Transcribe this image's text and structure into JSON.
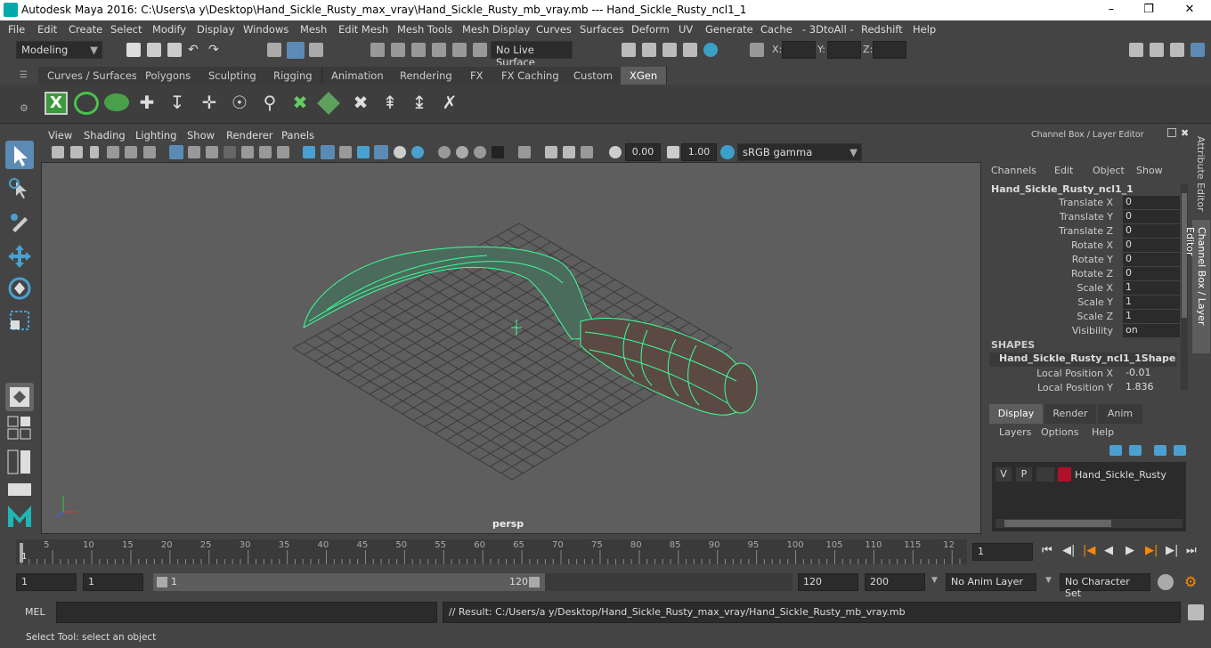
{
  "title": {
    "text": "Autodesk Maya 2016: C:\\Users\\a y\\Desktop\\Hand_Sickle_Rusty_max_vray\\Hand_Sickle_Rusty_mb_vray.mb   ---   Hand_Sickle_Rusty_ncl1_1"
  },
  "menu": [
    "File",
    "Edit",
    "Create",
    "Select",
    "Modify",
    "Display",
    "Windows",
    "Mesh",
    "Edit Mesh",
    "Mesh Tools",
    "Mesh Display",
    "Curves",
    "Surfaces",
    "Deform",
    "UV",
    "Generate",
    "Cache",
    "- 3DtoAll -",
    "Redshift",
    "Help"
  ],
  "status": {
    "mode": "Modeling",
    "live_surface": "No Live Surface",
    "x_label": "X:",
    "y_label": "Y:",
    "z_label": "Z:"
  },
  "shelf_tabs": [
    "Curves / Surfaces",
    "Polygons",
    "Sculpting",
    "Rigging",
    "Animation",
    "Rendering",
    "FX",
    "FX Caching",
    "Custom",
    "XGen"
  ],
  "viewport": {
    "menu": [
      "View",
      "Shading",
      "Lighting",
      "Show",
      "Renderer",
      "Panels"
    ],
    "exposure": "0.00",
    "gamma": "1.00",
    "color_space": "sRGB gamma",
    "camera": "persp"
  },
  "channel_box": {
    "header": "Channel Box / Layer Editor",
    "menu": [
      "Channels",
      "Edit",
      "Object",
      "Show"
    ],
    "object": "Hand_Sickle_Rusty_ncl1_1",
    "attributes": [
      {
        "name": "Translate X",
        "value": "0"
      },
      {
        "name": "Translate Y",
        "value": "0"
      },
      {
        "name": "Translate Z",
        "value": "0"
      },
      {
        "name": "Rotate X",
        "value": "0"
      },
      {
        "name": "Rotate Y",
        "value": "0"
      },
      {
        "name": "Rotate Z",
        "value": "0"
      },
      {
        "name": "Scale X",
        "value": "1"
      },
      {
        "name": "Scale Y",
        "value": "1"
      },
      {
        "name": "Scale Z",
        "value": "1"
      },
      {
        "name": "Visibility",
        "value": "on"
      }
    ],
    "shapes_label": "SHAPES",
    "shape": "Hand_Sickle_Rusty_ncl1_1Shape",
    "shape_attributes": [
      {
        "name": "Local Position X",
        "value": "-0.01"
      },
      {
        "name": "Local Position Y",
        "value": "1.836"
      }
    ]
  },
  "layer_editor": {
    "tabs": [
      "Display",
      "Render",
      "Anim"
    ],
    "menu": [
      "Layers",
      "Options",
      "Help"
    ],
    "layer": {
      "v": "V",
      "p": "P",
      "name": "Hand_Sickle_Rusty",
      "color": "#b0102a"
    }
  },
  "side_tabs": [
    "Attribute Editor",
    "Channel Box / Layer Editor"
  ],
  "timeline": {
    "ticks": [
      "5",
      "10",
      "15",
      "20",
      "25",
      "30",
      "35",
      "40",
      "45",
      "50",
      "55",
      "60",
      "65",
      "70",
      "75",
      "80",
      "85",
      "90",
      "95",
      "100",
      "105",
      "110",
      "115",
      "12"
    ],
    "start_marker": "1",
    "current_frame": "1"
  },
  "range": {
    "start": "1",
    "playback_start": "1",
    "slider_start": "1",
    "slider_end": "120",
    "playback_end": "120",
    "end": "200",
    "anim_layer": "No Anim Layer",
    "char_set": "No Character Set"
  },
  "command": {
    "label": "MEL",
    "result": "// Result: C:/Users/a y/Desktop/Hand_Sickle_Rusty_max_vray/Hand_Sickle_Rusty_mb_vray.mb"
  },
  "help_line": "Select Tool: select an object"
}
